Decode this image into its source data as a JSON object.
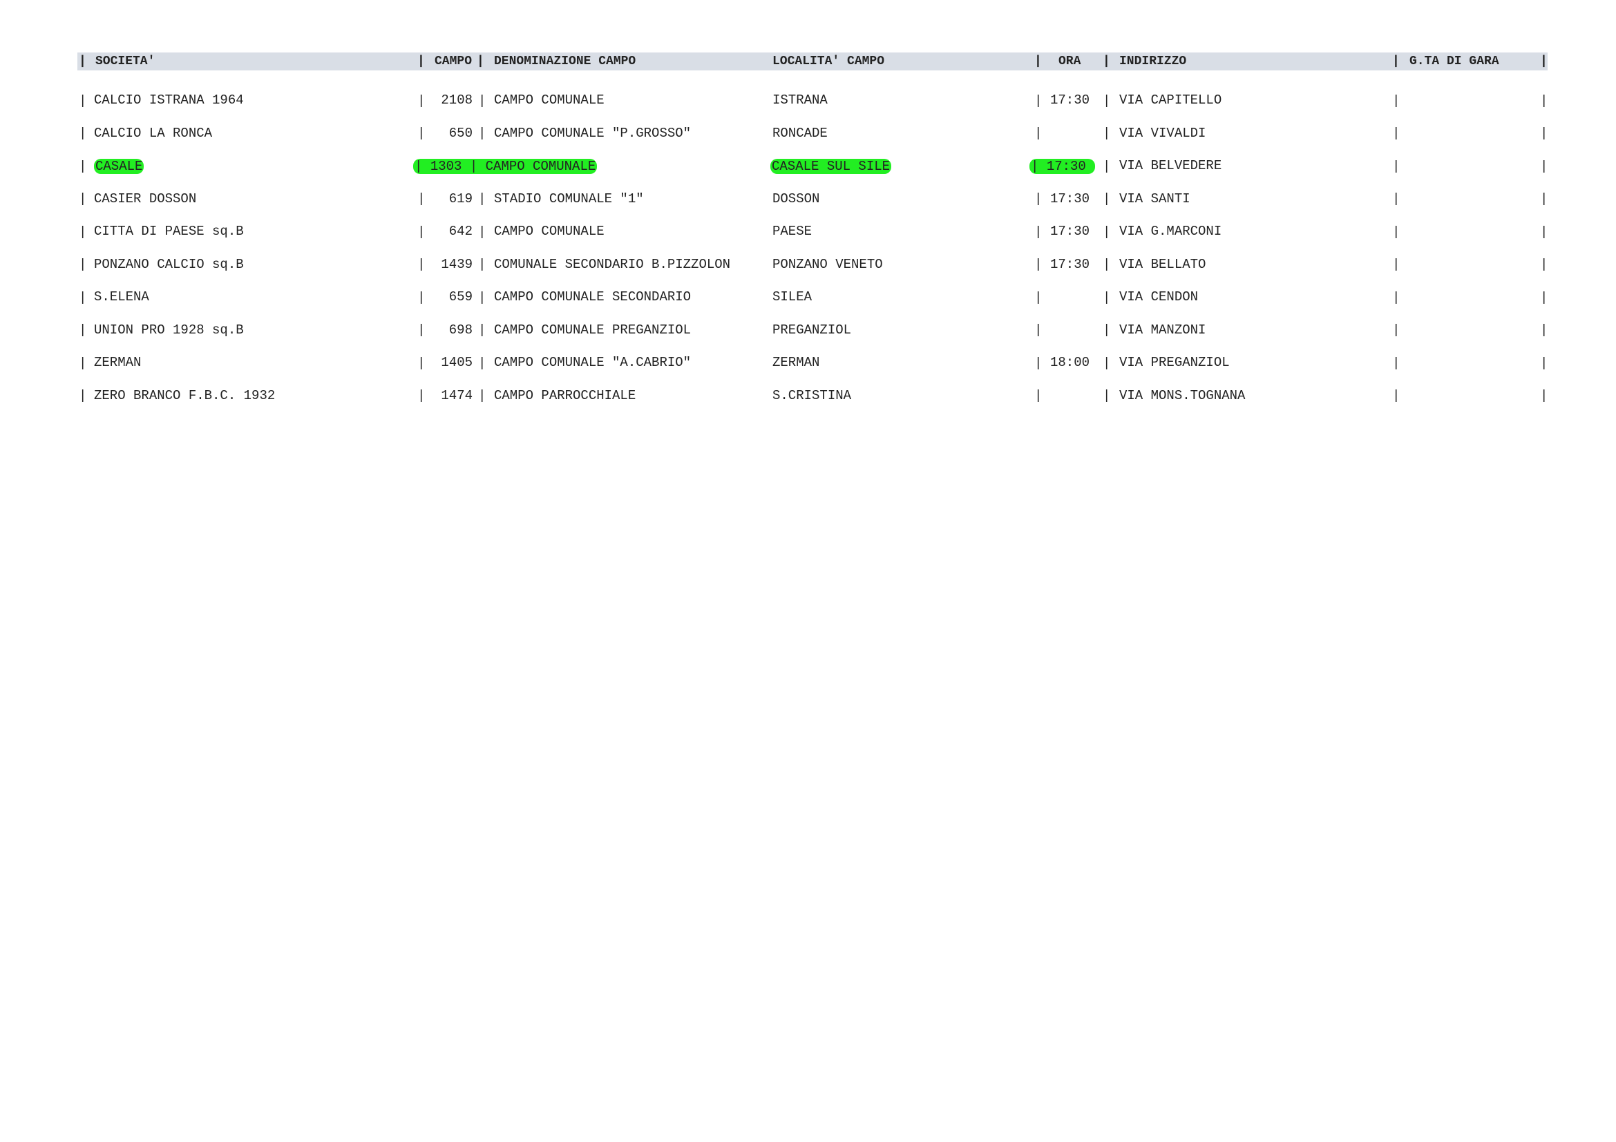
{
  "header": {
    "societa": "SOCIETA'",
    "campo": "CAMPO",
    "denominazione": "DENOMINAZIONE CAMPO",
    "localita": "LOCALITA' CAMPO",
    "ora": "ORA",
    "indirizzo": "INDIRIZZO",
    "giornata": "G.TA DI GARA"
  },
  "rows": [
    {
      "societa": "CALCIO ISTRANA 1964",
      "campo": "2108",
      "denominazione": "CAMPO COMUNALE",
      "localita": "ISTRANA",
      "ora": "17:30",
      "indirizzo": "VIA CAPITELLO",
      "giornata": "",
      "highlight": false
    },
    {
      "societa": "CALCIO LA RONCA",
      "campo": "650",
      "denominazione": "CAMPO COMUNALE \"P.GROSSO\"",
      "localita": "RONCADE",
      "ora": "",
      "indirizzo": "VIA VIVALDI",
      "giornata": "",
      "highlight": false
    },
    {
      "societa": "CASALE",
      "campo": "1303",
      "denominazione": "CAMPO COMUNALE",
      "localita": "CASALE SUL SILE",
      "ora": "17:30",
      "indirizzo": "VIA BELVEDERE",
      "giornata": "",
      "highlight": true
    },
    {
      "societa": "CASIER DOSSON",
      "campo": "619",
      "denominazione": "STADIO COMUNALE \"1\"",
      "localita": "DOSSON",
      "ora": "17:30",
      "indirizzo": "VIA SANTI",
      "giornata": "",
      "highlight": false
    },
    {
      "societa": "CITTA DI PAESE sq.B",
      "campo": "642",
      "denominazione": "CAMPO COMUNALE",
      "localita": "PAESE",
      "ora": "17:30",
      "indirizzo": "VIA G.MARCONI",
      "giornata": "",
      "highlight": false
    },
    {
      "societa": "PONZANO CALCIO sq.B",
      "campo": "1439",
      "denominazione": "COMUNALE SECONDARIO B.PIZZOLON",
      "localita": "PONZANO VENETO",
      "ora": "17:30",
      "indirizzo": "VIA BELLATO",
      "giornata": "",
      "highlight": false
    },
    {
      "societa": "S.ELENA",
      "campo": "659",
      "denominazione": "CAMPO COMUNALE SECONDARIO",
      "localita": "SILEA",
      "ora": "",
      "indirizzo": "VIA CENDON",
      "giornata": "",
      "highlight": false
    },
    {
      "societa": "UNION PRO 1928 sq.B",
      "campo": "698",
      "denominazione": "CAMPO COMUNALE PREGANZIOL",
      "localita": "PREGANZIOL",
      "ora": "",
      "indirizzo": "VIA MANZONI",
      "giornata": "",
      "highlight": false
    },
    {
      "societa": "ZERMAN",
      "campo": "1405",
      "denominazione": "CAMPO COMUNALE \"A.CABRIO\"",
      "localita": "ZERMAN",
      "ora": "18:00",
      "indirizzo": "VIA PREGANZIOL",
      "giornata": "",
      "highlight": false
    },
    {
      "societa": "ZERO BRANCO F.B.C. 1932",
      "campo": "1474",
      "denominazione": "CAMPO PARROCCHIALE",
      "localita": "S.CRISTINA",
      "ora": "",
      "indirizzo": "VIA MONS.TOGNANA",
      "giornata": "",
      "highlight": false
    }
  ],
  "colors": {
    "header_bg": "#d9dee6",
    "highlight": "#22ee22",
    "text": "#222222"
  }
}
